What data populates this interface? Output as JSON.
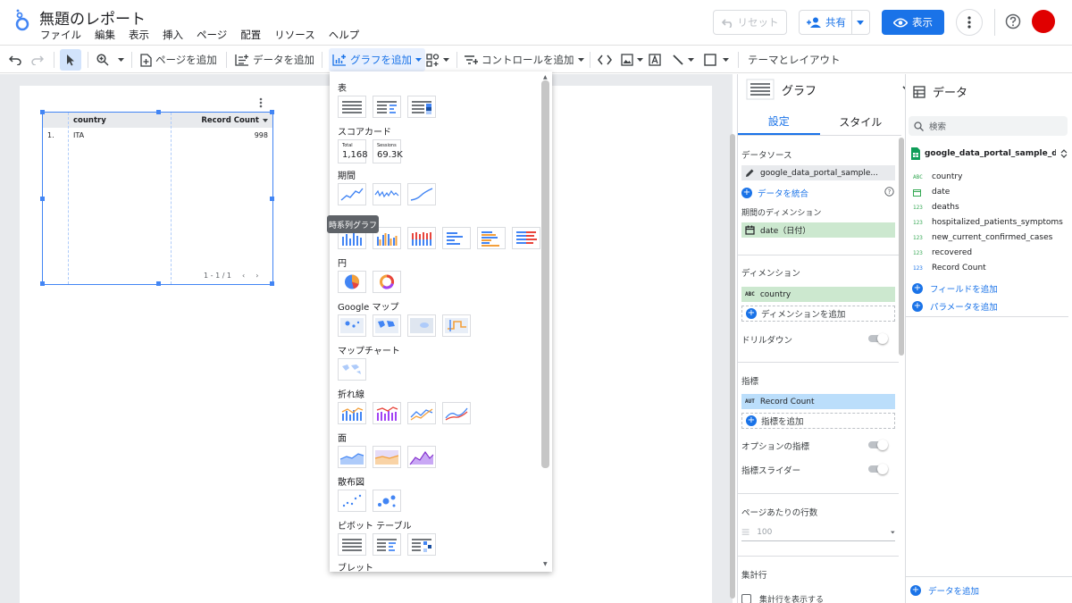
{
  "header": {
    "title": "無題のレポート",
    "menu": [
      "ファイル",
      "編集",
      "表示",
      "挿入",
      "ページ",
      "配置",
      "リソース",
      "ヘルプ"
    ],
    "reset_label": "リセット",
    "share_label": "共有",
    "view_label": "表示"
  },
  "toolbar": {
    "add_page": "ページを追加",
    "add_data": "データを追加",
    "add_chart": "グラフを追加",
    "add_control": "コントロールを追加",
    "theme_layout": "テーマとレイアウト"
  },
  "table_chart": {
    "columns": [
      "country",
      "Record Count"
    ],
    "rows": [
      {
        "index": "1.",
        "country": "ITA",
        "count": "998"
      }
    ],
    "pager": "1 - 1 / 1"
  },
  "chart_menu": {
    "sections": [
      "表",
      "スコアカード",
      "期間",
      "円",
      "Google マップ",
      "マップチャート",
      "折れ線",
      "面",
      "散布図",
      "ピボット テーブル",
      "ブレット"
    ],
    "scorecards": [
      {
        "label": "Total",
        "value": "1,168"
      },
      {
        "label": "Sessions",
        "value": "69.3K"
      }
    ],
    "tooltip": "時系列グラフ"
  },
  "props": {
    "header": "グラフ",
    "tabs": [
      "設定",
      "スタイル"
    ],
    "data_source_label": "データソース",
    "data_source_value": "google_data_portal_sample...",
    "blend_label": "データを統合",
    "date_range_dim_label": "期間のディメンション",
    "date_range_dim_value": "date（日付）",
    "dimension_label": "ディメンション",
    "dimension_value": "country",
    "dimension_type": "ABC",
    "add_dimension": "ディメンションを追加",
    "drilldown": "ドリルダウン",
    "metric_label": "指標",
    "metric_value": "Record Count",
    "metric_type": "AUT",
    "add_metric": "指標を追加",
    "optional_metrics": "オプションの指標",
    "metric_slider": "指標スライダー",
    "rows_per_page_label": "ページあたりの行数",
    "rows_per_page_value": "100",
    "summary_row_label": "集計行",
    "show_summary_row": "集計行を表示する"
  },
  "data_panel": {
    "header": "データ",
    "search_placeholder": "検索",
    "source": "google_data_portal_sample_data - ...",
    "fields": [
      {
        "type": "ABC",
        "name": "country"
      },
      {
        "type": "date",
        "name": "date"
      },
      {
        "type": "123",
        "name": "deaths"
      },
      {
        "type": "123",
        "name": "hospitalized_patients_symptoms"
      },
      {
        "type": "123",
        "name": "new_current_confirmed_cases"
      },
      {
        "type": "123",
        "name": "recovered"
      },
      {
        "type": "123",
        "name": "Record Count"
      }
    ],
    "add_field": "フィールドを追加",
    "add_parameter": "パラメータを追加",
    "add_data": "データを追加"
  },
  "colors": {
    "accent": "#1a73e8",
    "dimension_chip": "#cce8cf",
    "metric_chip": "#bbdefb",
    "avatar": "#e00000"
  }
}
